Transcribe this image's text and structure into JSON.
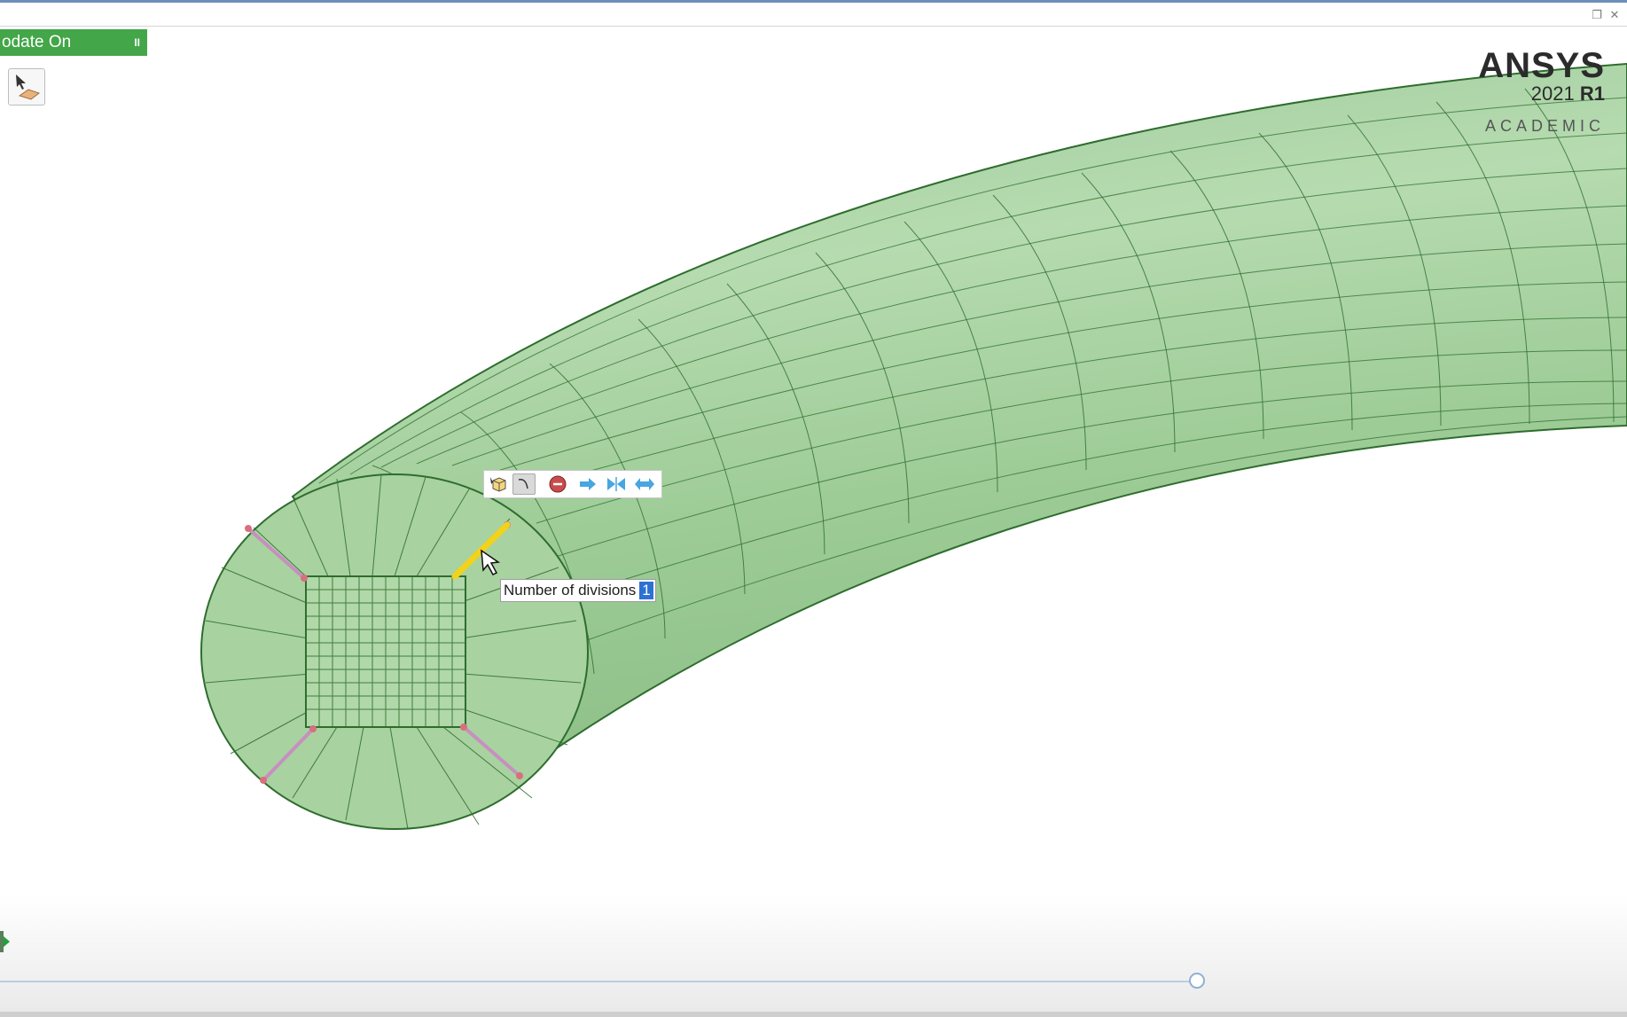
{
  "status": {
    "update_label": "odate On",
    "pause_glyph": "II"
  },
  "brand": {
    "name": "ANSYS",
    "version_prefix": "2021",
    "version_suffix": "R1",
    "edition": "ACADEMIC"
  },
  "mesh_control": {
    "field_label": "Number of divisions",
    "field_value": "1"
  },
  "toolbar": {
    "icons": [
      "cube-select-icon",
      "edge-curve-icon",
      "no-entry-icon",
      "arrow-right-icon",
      "bias-both-icon",
      "arrow-double-icon"
    ]
  },
  "colors": {
    "accent_green": "#43a648",
    "mesh_fill": "#a5cf9e",
    "mesh_line": "#2e6d2e",
    "selected_edge": "#f2d21b",
    "pink_edge": "#c78fc0",
    "input_highlight": "#2d72d2"
  }
}
